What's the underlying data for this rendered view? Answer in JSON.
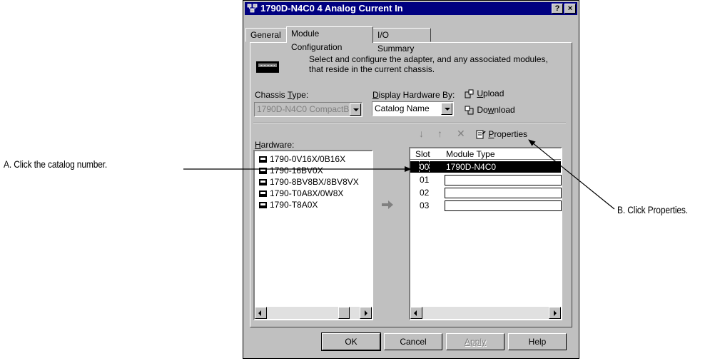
{
  "window": {
    "title": "1790D-N4C0 4 Analog Current In",
    "help_btn": "?",
    "close_btn": "×"
  },
  "tabs": [
    {
      "label": "General"
    },
    {
      "label": "Module Configuration"
    },
    {
      "label": "I/O Summary"
    }
  ],
  "intro": {
    "line1": "Select and configure the adapter, and any associated modules,",
    "line2": "that reside in the current chassis."
  },
  "chassis": {
    "label_pre": "Chassis ",
    "label_u": "T",
    "label_post": "ype:",
    "value": "1790D-N4C0 CompactB"
  },
  "display": {
    "label_u": "D",
    "label_post": "isplay Hardware By:",
    "value": "Catalog Name"
  },
  "upload": {
    "u": "U",
    "rest": "pload"
  },
  "download": {
    "pre": "Do",
    "u": "w",
    "rest": "nload"
  },
  "toolbar": {
    "down_arrow": "↓",
    "up_arrow": "↑",
    "delete": "✕",
    "properties_u": "P",
    "properties_rest": "roperties"
  },
  "hardware": {
    "label_u": "H",
    "label_rest": "ardware:",
    "items": [
      "1790-0V16X/0B16X",
      "1790-16BV0X",
      "1790-8BV8BX/8BV8VX",
      "1790-T0A8X/0W8X",
      "1790-T8A0X"
    ]
  },
  "slots": {
    "col_slot": "Slot",
    "col_type": "Module Type",
    "rows": [
      {
        "slot": "00",
        "type": "1790D-N4C0"
      },
      {
        "slot": "01",
        "type": ""
      },
      {
        "slot": "02",
        "type": ""
      },
      {
        "slot": "03",
        "type": ""
      }
    ]
  },
  "buttons": {
    "ok": "OK",
    "cancel": "Cancel",
    "apply": "Apply",
    "help": "Help"
  },
  "callouts": {
    "a": "A. Click the catalog number.",
    "b": "B. Click Properties."
  },
  "colors": {
    "titlebar": "#000080",
    "face": "#c0c0c0",
    "selection": "#000000"
  }
}
